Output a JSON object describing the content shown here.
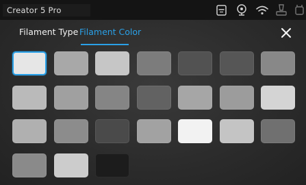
{
  "status_bar": {
    "device_name": "Creator 5 Pro",
    "icons": [
      "printer-icon",
      "camera-icon",
      "wifi-icon",
      "user-icon",
      "filament-icon"
    ]
  },
  "tabs": [
    {
      "label": "Filament Type",
      "active": false
    },
    {
      "label": "Filament Color",
      "active": true
    }
  ],
  "accent_color": "#2aa1e8",
  "colors": [
    {
      "hex": "#e6e6e6",
      "selected": true
    },
    {
      "hex": "#a8a8a8"
    },
    {
      "hex": "#c6c6c6"
    },
    {
      "hex": "#7c7c7c"
    },
    {
      "hex": "#525252"
    },
    {
      "hex": "#565656"
    },
    {
      "hex": "#888888"
    },
    {
      "hex": "#bababa"
    },
    {
      "hex": "#a0a0a0"
    },
    {
      "hex": "#858585"
    },
    {
      "hex": "#626262"
    },
    {
      "hex": "#a6a6a6"
    },
    {
      "hex": "#9c9c9c"
    },
    {
      "hex": "#d4d4d4"
    },
    {
      "hex": "#b0b0b0"
    },
    {
      "hex": "#8c8c8c"
    },
    {
      "hex": "#4a4a4a"
    },
    {
      "hex": "#a2a2a2"
    },
    {
      "hex": "#f2f2f2"
    },
    {
      "hex": "#c4c4c4"
    },
    {
      "hex": "#707070"
    },
    {
      "hex": "#8a8a8a"
    },
    {
      "hex": "#cccccc"
    },
    {
      "hex": "#1c1c1c"
    }
  ]
}
